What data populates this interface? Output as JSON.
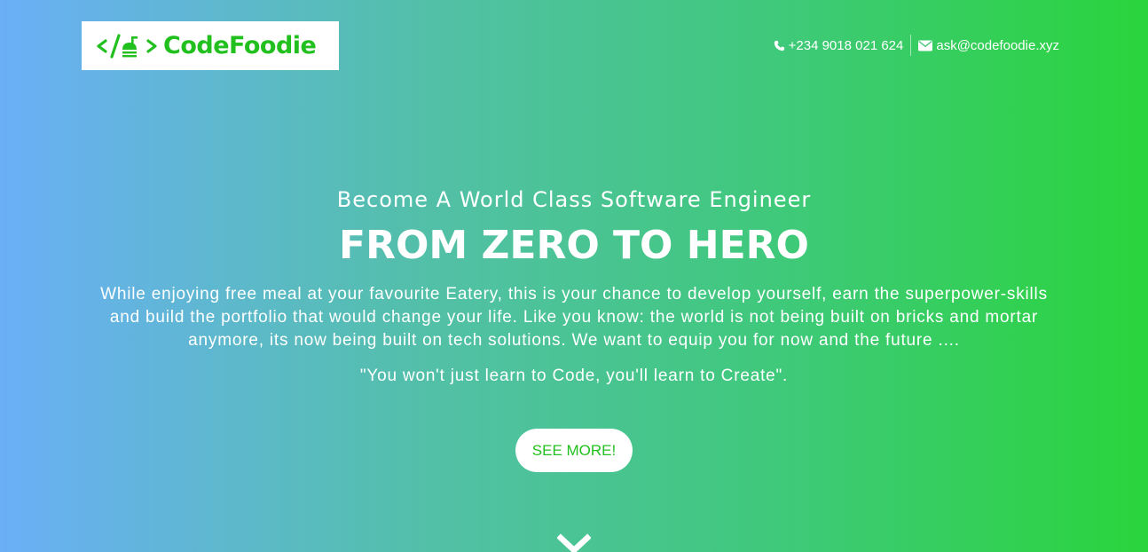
{
  "header": {
    "brand": {
      "name": "CodeFoodie",
      "icon": "code-burger-logo-icon",
      "color": "#22c01e"
    },
    "contacts": [
      {
        "icon": "phone-icon",
        "text": "+234 9018 021 624"
      },
      {
        "icon": "envelope-icon",
        "text": "ask@codefoodie.xyz"
      }
    ]
  },
  "hero": {
    "subtitle": "Become A World Class Software Engineer",
    "headline": "FROM ZERO TO HERO",
    "description": "While enjoying free meal at your favourite Eatery, this is your chance to develop yourself, earn the superpower-skills and build the portfolio that would change your life. Like you know: the world is not being built on bricks and mortar anymore, its now being built on tech solutions. We want to equip you for now and the future ....",
    "quote": "\"You won't just learn to Code, you'll learn to Create\".",
    "cta_label": "SEE MORE!",
    "scroll_icon": "chevron-down-icon"
  },
  "colors": {
    "gradient_start": "#6aaff7",
    "gradient_end": "#2ad43c",
    "accent": "#22c01e"
  }
}
